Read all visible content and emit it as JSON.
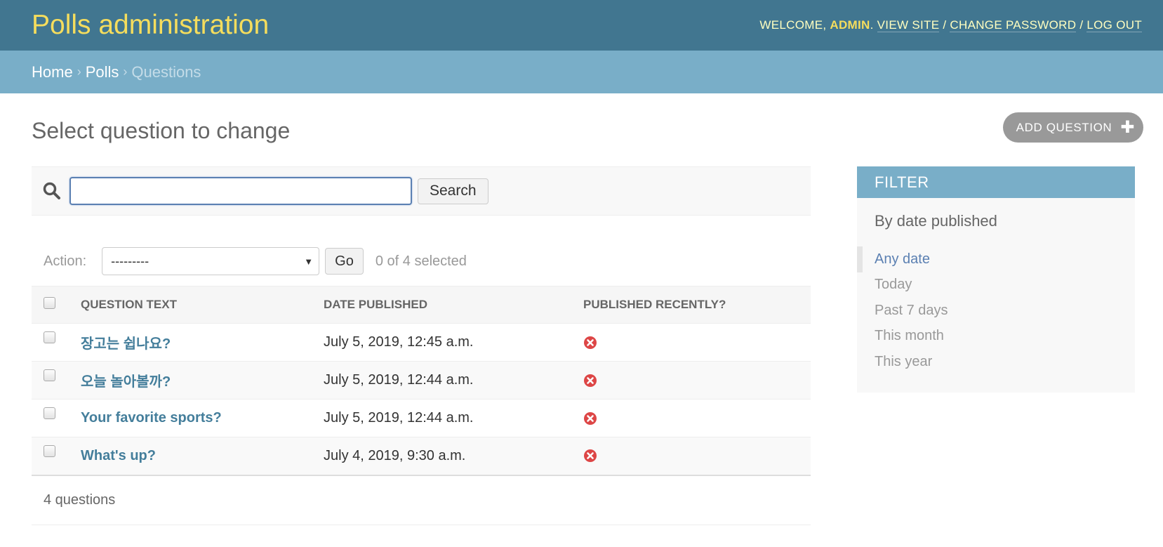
{
  "header": {
    "site_name": "Polls administration",
    "welcome": "Welcome,",
    "username": "admin",
    "view_site": "View site",
    "change_password": "Change password",
    "log_out": "Log out"
  },
  "breadcrumbs": {
    "home": "Home",
    "app": "Polls",
    "current": "Questions"
  },
  "page": {
    "title": "Select question to change",
    "add_button": "Add question"
  },
  "search": {
    "value": "",
    "button": "Search"
  },
  "actions": {
    "label": "Action:",
    "selected_option": "---------",
    "go_button": "Go",
    "selected_count": "0 of 4 selected"
  },
  "table": {
    "columns": [
      "Question text",
      "Date published",
      "Published recently?"
    ],
    "rows": [
      {
        "question_text": "장고는 쉽나요?",
        "date_published": "July 5, 2019, 12:45 a.m.",
        "published_recently": false
      },
      {
        "question_text": "오늘 놀아볼까?",
        "date_published": "July 5, 2019, 12:44 a.m.",
        "published_recently": false
      },
      {
        "question_text": "Your favorite sports?",
        "date_published": "July 5, 2019, 12:44 a.m.",
        "published_recently": false
      },
      {
        "question_text": "What's up?",
        "date_published": "July 4, 2019, 9:30 a.m.",
        "published_recently": false
      }
    ]
  },
  "paginator": "4 questions",
  "filter": {
    "title": "Filter",
    "heading": "By date published",
    "options": [
      "Any date",
      "Today",
      "Past 7 days",
      "This month",
      "This year"
    ],
    "selected": "Any date"
  },
  "colors": {
    "header_bg": "#417690",
    "breadcrumbs_bg": "#79aec8",
    "site_name": "#f5dd5d",
    "link": "#447e9b",
    "no_icon": "#dd4646"
  },
  "icons": {
    "search": "search-icon",
    "add": "plus-icon",
    "boolean_false": "icon-no"
  }
}
